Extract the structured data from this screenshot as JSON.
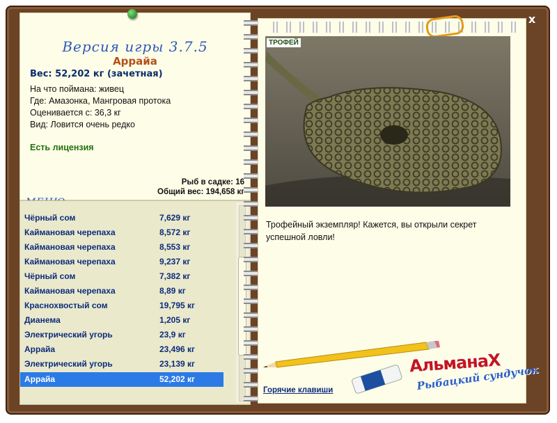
{
  "window": {
    "close_label": "x"
  },
  "left_panel": {
    "version": "Версия игры 3.7.5",
    "fish_name": "Аррайа",
    "weight_line": "Вес: 52,202 кг (зачетная)",
    "details": [
      "На что поймана: живец",
      "Где: Амазонка, Мангровая протока",
      "Оценивается с: 36,3 кг",
      "Вид: Ловится очень редко"
    ],
    "license": "Есть лицензия",
    "cage_count": "Рыб в садке: 16",
    "total_weight": "Общий вес: 194,658 кг",
    "menu": "МЕНЮ"
  },
  "catch_list": {
    "rows": [
      {
        "name": "Чёрный сом",
        "weight": "7,629 кг"
      },
      {
        "name": "Каймановая черепаха",
        "weight": "8,572 кг"
      },
      {
        "name": "Каймановая черепаха",
        "weight": "8,553 кг"
      },
      {
        "name": "Каймановая черепаха",
        "weight": "9,237 кг"
      },
      {
        "name": "Чёрный сом",
        "weight": "7,382 кг"
      },
      {
        "name": "Каймановая черепаха",
        "weight": "8,89 кг"
      },
      {
        "name": "Краснохвостый сом",
        "weight": "19,795 кг"
      },
      {
        "name": "Дианема",
        "weight": "1,205 кг"
      },
      {
        "name": "Электрический угорь",
        "weight": "23,9 кг"
      },
      {
        "name": "Аррайа",
        "weight": "23,496 кг"
      },
      {
        "name": "Электрический угорь",
        "weight": "23,139 кг"
      },
      {
        "name": "Аррайа",
        "weight": "52,202 кг"
      }
    ],
    "selected_index": 11
  },
  "right_panel": {
    "trophy_label": "ТРОФЕЙ",
    "description": "Трофейный экземпляр! Кажется, вы открыли секрет успешной ловли!",
    "hotkeys": "Горячие клавиши",
    "logo_title": "АльманаХ",
    "logo_subtitle": "Рыбацкий сундучок"
  },
  "colors": {
    "frame": "#6b4326",
    "selected_row": "#2b7ae6",
    "name_blue": "#0d2c7a",
    "license_green": "#23700f",
    "fish_title": "#b3501a"
  }
}
